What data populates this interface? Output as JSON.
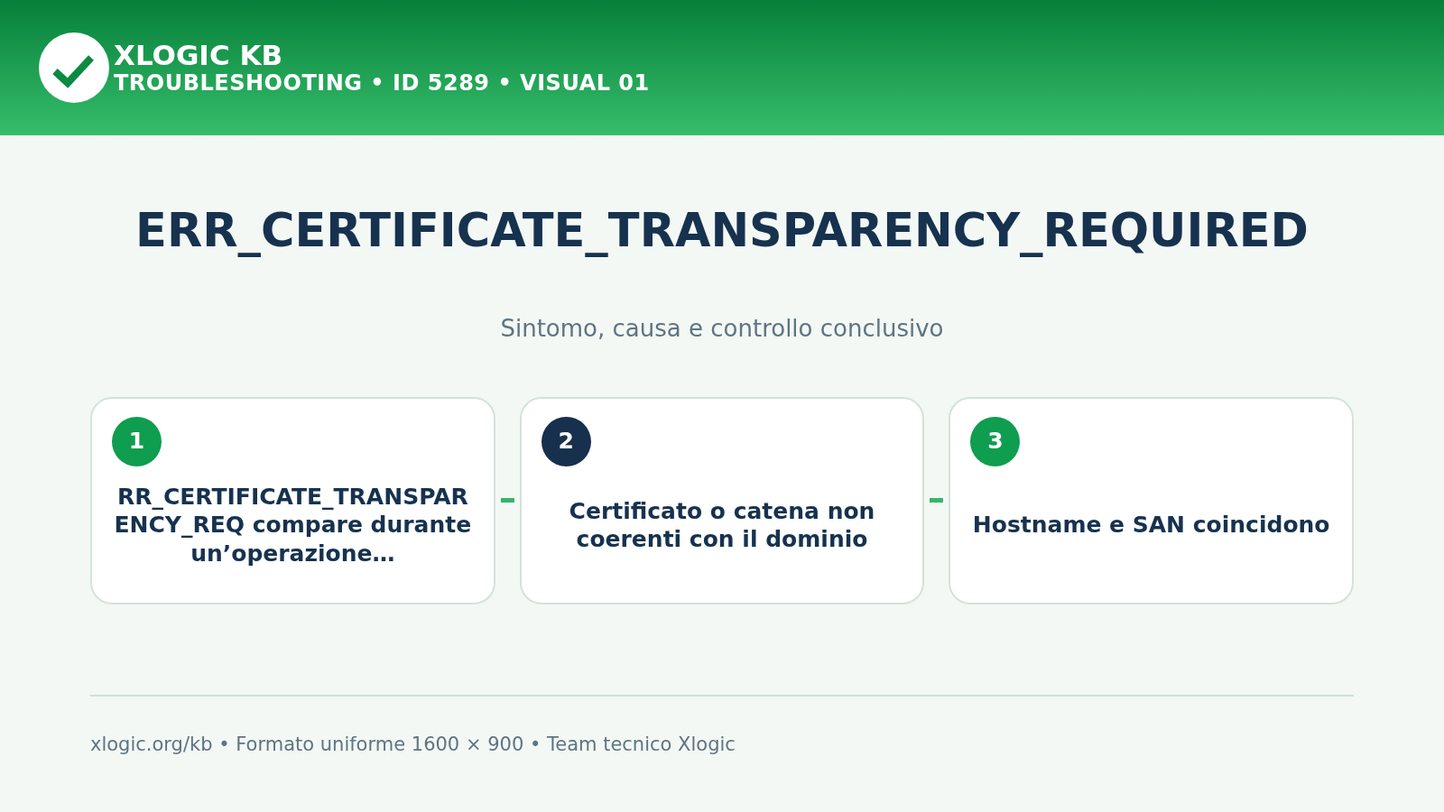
{
  "header": {
    "brand": "XLOGIC KB",
    "subtitle": "TROUBLESHOOTING • ID 5289 • VISUAL 01"
  },
  "title": "ERR_CERTIFICATE_TRANSPARENCY_REQUIRED",
  "subtitle": "Sintomo, causa e controllo conclusivo",
  "steps": [
    {
      "number": "1",
      "color": "#0f9d4f",
      "text": "RR_CERTIFICATE_TRANSPARENCY_REQ compare durante un’operazione…"
    },
    {
      "number": "2",
      "color": "#17304d",
      "text": "Certificato o catena non coerenti con il dominio"
    },
    {
      "number": "3",
      "color": "#0f9d4f",
      "text": "Hostname e SAN coincidono"
    }
  ],
  "footer": "xlogic.org/kb • Formato uniforme 1600 × 900 • Team tecnico Xlogic"
}
